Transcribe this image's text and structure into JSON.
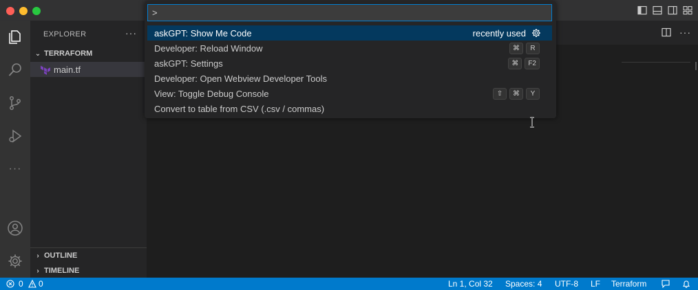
{
  "explorer": {
    "header": "EXPLORER",
    "more": "···",
    "folder": "TERRAFORM",
    "file": "main.tf",
    "outline": "OUTLINE",
    "timeline": "TIMELINE"
  },
  "activity_bar": {
    "items": [
      "files-icon",
      "search-icon",
      "source-control-icon",
      "run-debug-icon",
      "more-icon"
    ],
    "bottom": [
      "account-icon",
      "manage-gear-icon"
    ],
    "more_label": "···"
  },
  "editor_actions": {
    "more": "···"
  },
  "command_palette": {
    "input_value": ">",
    "items": [
      {
        "label": "askGPT: Show Me Code",
        "right_text": "recently used",
        "keys": []
      },
      {
        "label": "Developer: Reload Window",
        "right_text": "",
        "keys": [
          "⌘",
          "R"
        ]
      },
      {
        "label": "askGPT: Settings",
        "right_text": "",
        "keys": [
          "⌘",
          "F2"
        ]
      },
      {
        "label": "Developer: Open Webview Developer Tools",
        "right_text": "",
        "keys": []
      },
      {
        "label": "View: Toggle Debug Console",
        "right_text": "",
        "keys": [
          "⇧",
          "⌘",
          "Y"
        ]
      },
      {
        "label": "Convert to table from CSV (.csv / commas)",
        "right_text": "",
        "keys": []
      }
    ]
  },
  "status_bar": {
    "errors": "0",
    "warnings": "0",
    "position": "Ln 1, Col 32",
    "spaces": "Spaces: 4",
    "encoding": "UTF-8",
    "eol": "LF",
    "language": "Terraform"
  },
  "colors": {
    "accent": "#007acc",
    "selection": "#04395e",
    "focus_border": "#007fd4",
    "terraform_purple": "#7b42bc"
  }
}
